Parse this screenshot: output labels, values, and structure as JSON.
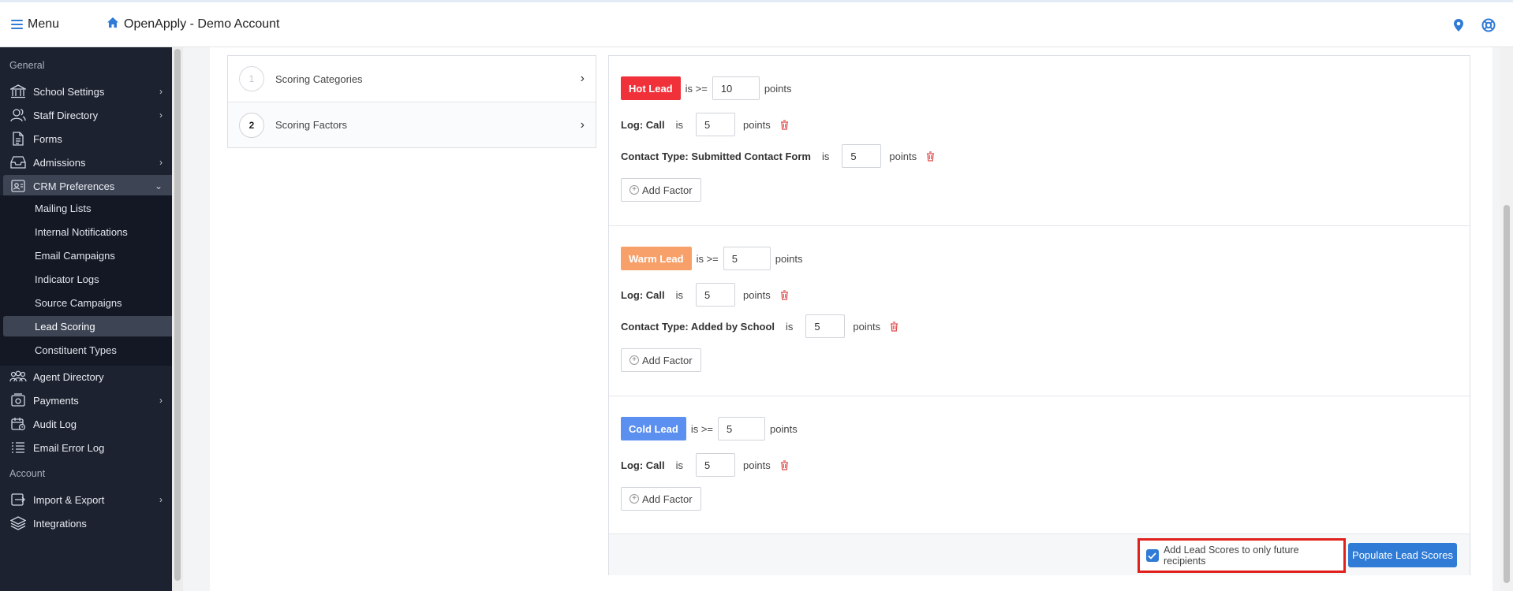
{
  "topbar": {
    "menu_label": "Menu",
    "brand_label": "OpenApply - Demo Account"
  },
  "sidebar": {
    "section_general": "General",
    "section_account": "Account",
    "items": {
      "school_settings": "School Settings",
      "staff_directory": "Staff Directory",
      "forms": "Forms",
      "admissions": "Admissions",
      "crm_preferences": "CRM Preferences",
      "agent_directory": "Agent Directory",
      "payments": "Payments",
      "audit_log": "Audit Log",
      "email_error_log": "Email Error Log",
      "import_export": "Import & Export",
      "integrations": "Integrations"
    },
    "crm_sub": {
      "mailing_lists": "Mailing Lists",
      "internal_notifications": "Internal Notifications",
      "email_campaigns": "Email Campaigns",
      "indicator_logs": "Indicator Logs",
      "source_campaigns": "Source Campaigns",
      "lead_scoring": "Lead Scoring",
      "constituent_types": "Constituent Types"
    }
  },
  "steps": [
    {
      "number": "1",
      "label": "Scoring Categories"
    },
    {
      "number": "2",
      "label": "Scoring Factors"
    }
  ],
  "groups": [
    {
      "badge": "Hot Lead",
      "badge_color": "#f0313a",
      "comparator": "is >=",
      "threshold": "10",
      "points": "points",
      "factors": [
        {
          "label": "Log: Call",
          "is": "is",
          "value": "5",
          "points": "points"
        },
        {
          "label": "Contact Type: Submitted Contact Form",
          "is": "is",
          "value": "5",
          "points": "points"
        }
      ],
      "add_label": "Add Factor"
    },
    {
      "badge": "Warm Lead",
      "badge_color": "#f8a06a",
      "comparator": "is >=",
      "threshold": "5",
      "points": "points",
      "factors": [
        {
          "label": "Log: Call",
          "is": "is",
          "value": "5",
          "points": "points"
        },
        {
          "label": "Contact Type: Added by School",
          "is": "is",
          "value": "5",
          "points": "points"
        }
      ],
      "add_label": "Add Factor"
    },
    {
      "badge": "Cold Lead",
      "badge_color": "#5b8ff0",
      "comparator": "is >=",
      "threshold": "5",
      "points": "points",
      "factors": [
        {
          "label": "Log: Call",
          "is": "is",
          "value": "5",
          "points": "points"
        }
      ],
      "add_label": "Add Factor"
    }
  ],
  "footer": {
    "future_label": "Add Lead Scores to only future recipients",
    "future_checked": true,
    "populate_label": "Populate Lead Scores"
  },
  "icons": {
    "menu": "hamburger-icon",
    "home": "home-icon",
    "location": "location-pin-icon",
    "help": "lifebuoy-icon",
    "delete": "trash-icon"
  },
  "colors": {
    "accent": "#2f7bd6",
    "sidebar_bg": "#1d2230",
    "danger": "#e0201c"
  }
}
